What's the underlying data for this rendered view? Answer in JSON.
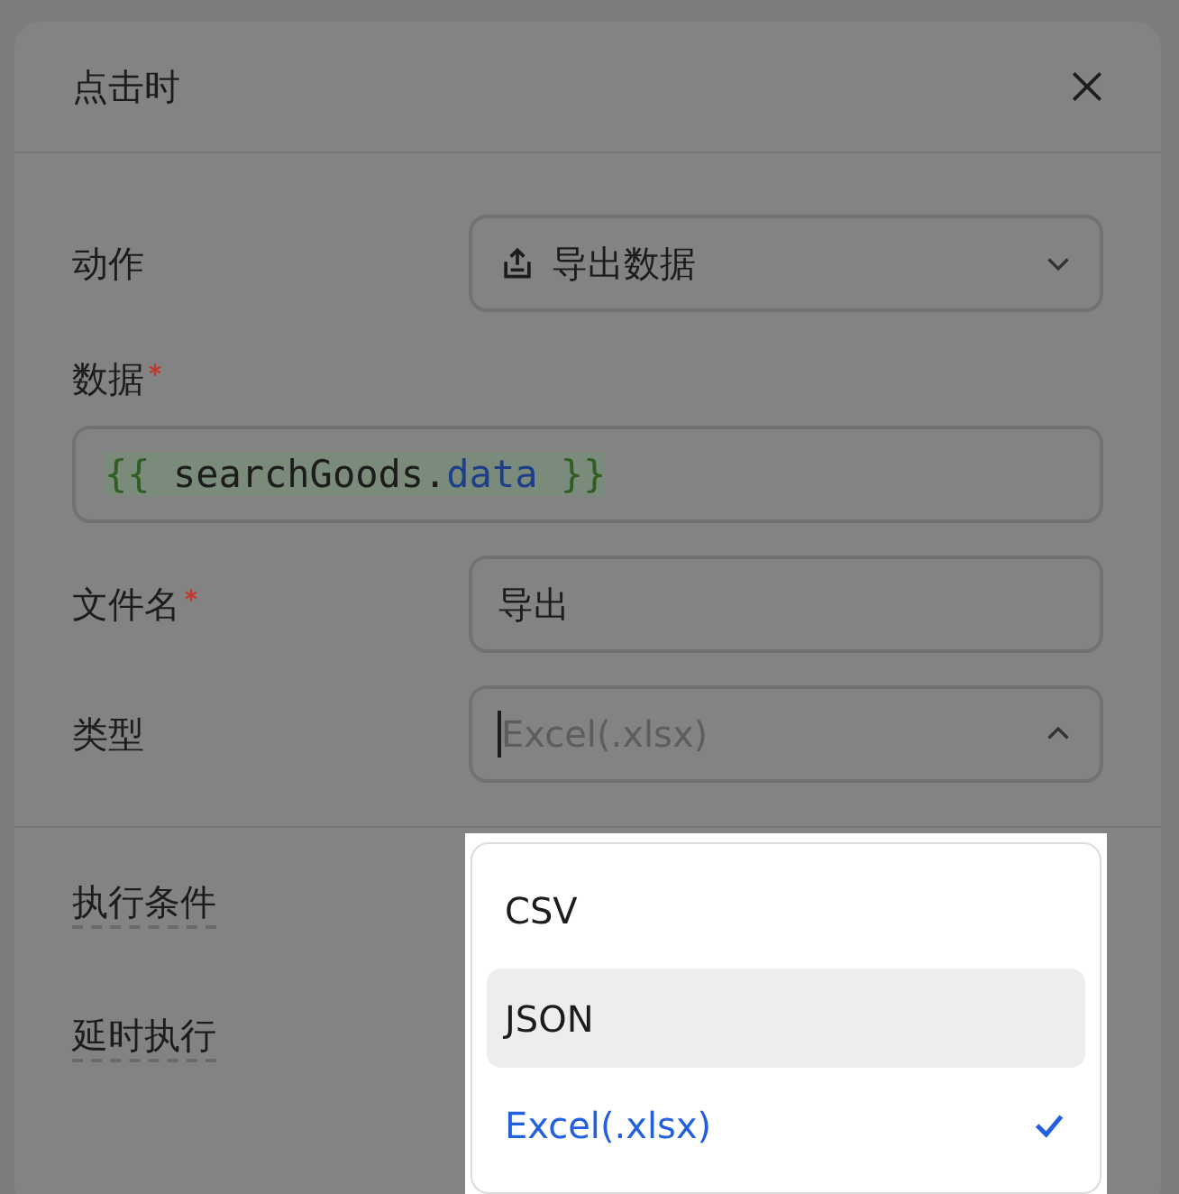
{
  "dialog": {
    "title": "点击时"
  },
  "fields": [
    {
      "kind": "select",
      "label": "动作",
      "required": false,
      "value": "导出数据",
      "expanded": false
    },
    {
      "kind": "code",
      "label": "数据",
      "required": true,
      "tokens": [
        {
          "kind": "brace",
          "text": "{{ "
        },
        {
          "kind": "ident",
          "text": "searchGoods."
        },
        {
          "kind": "prop",
          "text": "data"
        },
        {
          "kind": "brace",
          "text": " }}"
        }
      ]
    },
    {
      "kind": "text",
      "label": "文件名",
      "required": true,
      "value": "导出"
    },
    {
      "kind": "combo",
      "label": "类型",
      "required": false,
      "placeholder": "Excel(.xlsx)",
      "focused": true,
      "expanded": true
    }
  ],
  "extra_rows": [
    {
      "label": "执行条件"
    },
    {
      "label": "延时执行"
    }
  ],
  "dropdown": {
    "options": [
      {
        "label": "CSV",
        "selected": false,
        "highlighted": false
      },
      {
        "label": "JSON",
        "selected": false,
        "highlighted": true
      },
      {
        "label": "Excel(.xlsx)",
        "selected": true,
        "highlighted": false
      }
    ]
  }
}
